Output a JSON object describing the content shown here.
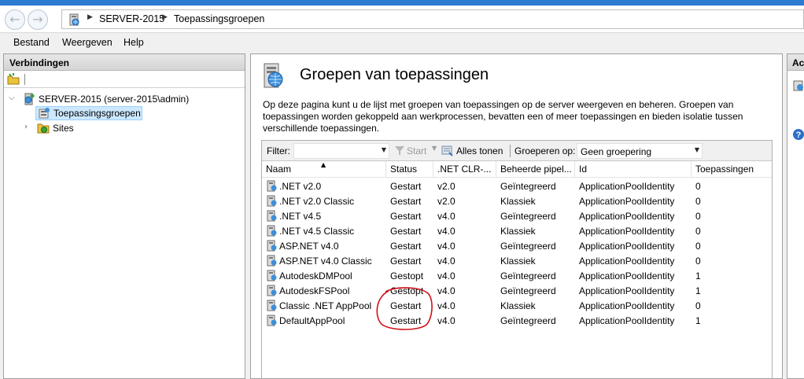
{
  "breadcrumb": [
    "SERVER-2015",
    "Toepassingsgroepen"
  ],
  "menu": [
    "Bestand",
    "Weergeven",
    "Help"
  ],
  "connections": {
    "title": "Verbindingen",
    "server": "SERVER-2015 (server-2015\\admin)",
    "items": [
      "Toepassingsgroepen",
      "Sites"
    ]
  },
  "page": {
    "title": "Groepen van toepassingen",
    "description": "Op deze pagina kunt u de lijst met groepen van toepassingen op de server weergeven en beheren. Groepen van toepassingen worden gekoppeld aan werkprocessen, bevatten een of meer toepassingen en bieden isolatie tussen verschillende toepassingen."
  },
  "filter": {
    "label": "Filter:",
    "value": "",
    "start_label": "Start",
    "show_all_label": "Alles tonen",
    "group_label": "Groeperen op:",
    "group_value": "Geen groepering"
  },
  "columns": [
    "Naam",
    "Status",
    ".NET CLR-...",
    "Beheerde pipel...",
    "Id",
    "Toepassingen"
  ],
  "rows": [
    [
      ".NET v2.0",
      "Gestart",
      "v2.0",
      "Geïntegreerd",
      "ApplicationPoolIdentity",
      "0"
    ],
    [
      ".NET v2.0 Classic",
      "Gestart",
      "v2.0",
      "Klassiek",
      "ApplicationPoolIdentity",
      "0"
    ],
    [
      ".NET v4.5",
      "Gestart",
      "v4.0",
      "Geïntegreerd",
      "ApplicationPoolIdentity",
      "0"
    ],
    [
      ".NET v4.5 Classic",
      "Gestart",
      "v4.0",
      "Klassiek",
      "ApplicationPoolIdentity",
      "0"
    ],
    [
      "ASP.NET v4.0",
      "Gestart",
      "v4.0",
      "Geïntegreerd",
      "ApplicationPoolIdentity",
      "0"
    ],
    [
      "ASP.NET v4.0 Classic",
      "Gestart",
      "v4.0",
      "Klassiek",
      "ApplicationPoolIdentity",
      "0"
    ],
    [
      "AutodeskDMPool",
      "Gestopt",
      "v4.0",
      "Geïntegreerd",
      "ApplicationPoolIdentity",
      "1"
    ],
    [
      "AutodeskFSPool",
      "Gestopt",
      "v4.0",
      "Geïntegreerd",
      "ApplicationPoolIdentity",
      "1"
    ],
    [
      "Classic .NET AppPool",
      "Gestart",
      "v4.0",
      "Klassiek",
      "ApplicationPoolIdentity",
      "0"
    ],
    [
      "DefaultAppPool",
      "Gestart",
      "v4.0",
      "Geïntegreerd",
      "ApplicationPoolIdentity",
      "1"
    ]
  ],
  "actions": {
    "title": "Ac"
  },
  "colors": {
    "annotation": "#d0101a",
    "selection": "#cce8ff",
    "titlebar": "#2b7bd1"
  }
}
